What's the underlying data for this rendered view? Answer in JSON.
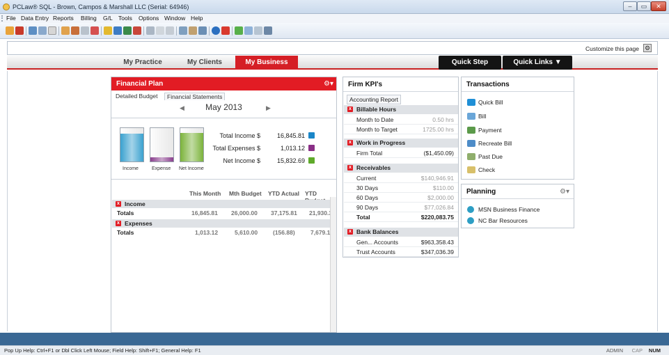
{
  "window": {
    "title": "PCLaw® SQL - Brown, Campos & Marshall LLC (Serial: 64946)",
    "min": "–",
    "max": "▭",
    "close": "✕"
  },
  "menu": [
    "File",
    "Data Entry",
    "Reports",
    "Billing",
    "G/L",
    "Tools",
    "Options",
    "Window",
    "Help"
  ],
  "customize": {
    "label": "Customize this page",
    "gear": "⚙"
  },
  "nav": {
    "tabs": [
      "My Practice",
      "My Clients",
      "My Business"
    ],
    "active": "My Business",
    "quick_step": "Quick Step",
    "quick_links": "Quick Links ▼"
  },
  "financial_plan": {
    "title": "Financial Plan",
    "gear": "⚙▾",
    "subtabs": [
      "Detailed Budget",
      "Financial Statements"
    ],
    "month": "May 2013",
    "prev": "◀",
    "next": "▶",
    "gauges": [
      {
        "label": "Income",
        "level": 0.83,
        "color": "#3aa1cf"
      },
      {
        "label": "Expense",
        "level": 0.13,
        "color": "#8a3f8e"
      },
      {
        "label": "Net Income",
        "level": 0.86,
        "color": "#7bb33b"
      }
    ],
    "summary": [
      {
        "label": "Total Income $",
        "value": "16,845.81",
        "color": "#1a86c8"
      },
      {
        "label": "Total Expenses $",
        "value": "1,013.12",
        "color": "#8a2f86"
      },
      {
        "label": "Net Income $",
        "value": "15,832.69",
        "color": "#5faa2a"
      }
    ],
    "columns": [
      "This Month",
      "Mth Budget",
      "YTD Actual",
      "YTD Budget"
    ],
    "groups": [
      {
        "name": "Income",
        "totals_label": "Totals",
        "totals": [
          "16,845.81",
          "26,000.00",
          "37,175.81",
          "21,930.39"
        ]
      },
      {
        "name": "Expenses",
        "totals_label": "Totals",
        "totals": [
          "1,013.12",
          "5,610.00",
          "(156.88)",
          "7,679.14"
        ]
      }
    ],
    "x": "x"
  },
  "kpis": {
    "title": "Firm KPI's",
    "subtab": "Accounting Report",
    "sections": [
      {
        "name": "Billable Hours",
        "rows": [
          {
            "label": "Month to Date",
            "value": "0.50 hrs"
          },
          {
            "label": "Month to Target",
            "value": "1725.00 hrs"
          }
        ]
      },
      {
        "name": "Work in Progress",
        "rows": [
          {
            "label": "Firm Total",
            "value": "($1,450.09)"
          }
        ]
      },
      {
        "name": "Receivables",
        "rows": [
          {
            "label": "Current",
            "value": "$140,946.91"
          },
          {
            "label": "30 Days",
            "value": "$110.00"
          },
          {
            "label": "60 Days",
            "value": "$2,000.00"
          },
          {
            "label": "90 Days",
            "value": "$77,026.84"
          },
          {
            "label": "Total",
            "value": "$220,083.75"
          }
        ]
      },
      {
        "name": "Bank Balances",
        "rows": [
          {
            "label": "Gen... Accounts",
            "value": "$963,358.43"
          },
          {
            "label": "Trust Accounts",
            "value": "$347,036.39"
          }
        ]
      }
    ]
  },
  "transactions": {
    "title": "Transactions",
    "items": [
      "Quick Bill",
      "Bill",
      "Payment",
      "Recreate Bill",
      "Past Due",
      "Check"
    ]
  },
  "planning": {
    "title": "Planning",
    "gear": "⚙▾",
    "items": [
      "MSN Business Finance",
      "NC Bar Resources"
    ]
  },
  "status": {
    "help": "Pop Up Help: Ctrl+F1 or Dbl Click Left Mouse; Field Help: Shift+F1; General Help: F1",
    "user": "ADMIN",
    "cap": "CAP",
    "num": "NUM"
  }
}
